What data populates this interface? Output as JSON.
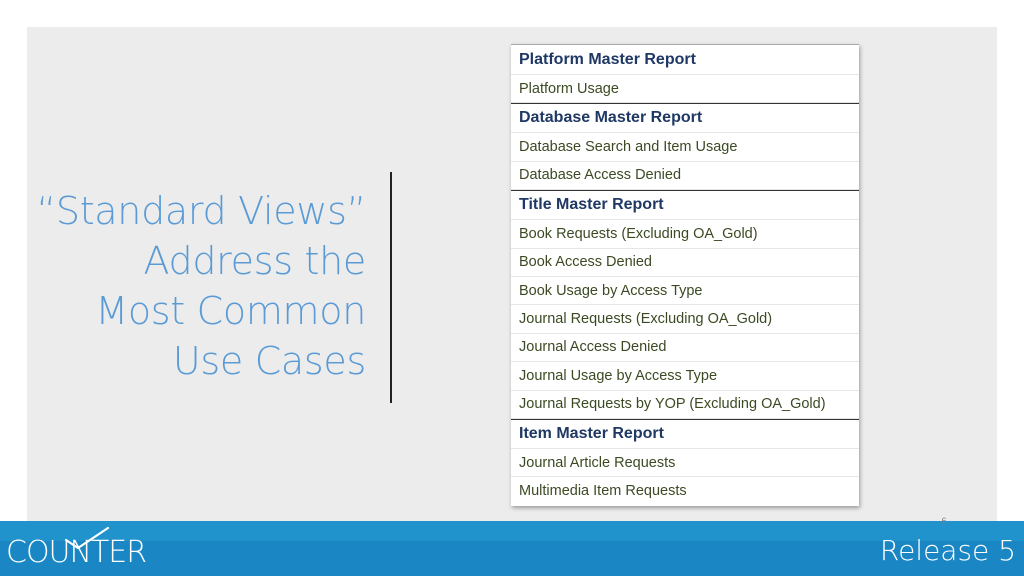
{
  "title_lines": [
    "“Standard Views”",
    "Address the",
    "Most Common",
    "Use Cases"
  ],
  "reports": [
    {
      "name": "Platform Master Report",
      "views": [
        "Platform Usage"
      ]
    },
    {
      "name": "Database Master Report",
      "views": [
        "Database Search and Item Usage",
        "Database Access Denied"
      ]
    },
    {
      "name": "Title Master Report",
      "views": [
        "Book Requests (Excluding OA_Gold)",
        "Book Access Denied",
        "Book Usage by Access Type",
        "Journal Requests (Excluding OA_Gold)",
        "Journal Access Denied",
        "Journal Usage by Access Type",
        "Journal Requests by YOP (Excluding OA_Gold)"
      ]
    },
    {
      "name": "Item Master Report",
      "views": [
        "Journal Article Requests",
        "Multimedia Item Requests"
      ]
    }
  ],
  "footer": {
    "page_number": "6",
    "logo_text": "COUNTER",
    "release_label": "Release 5"
  },
  "colors": {
    "title": "#5b9bd5",
    "report_header": "#1f3864",
    "view_item": "#3b4a23",
    "footer_bar": "#1a87c4"
  }
}
